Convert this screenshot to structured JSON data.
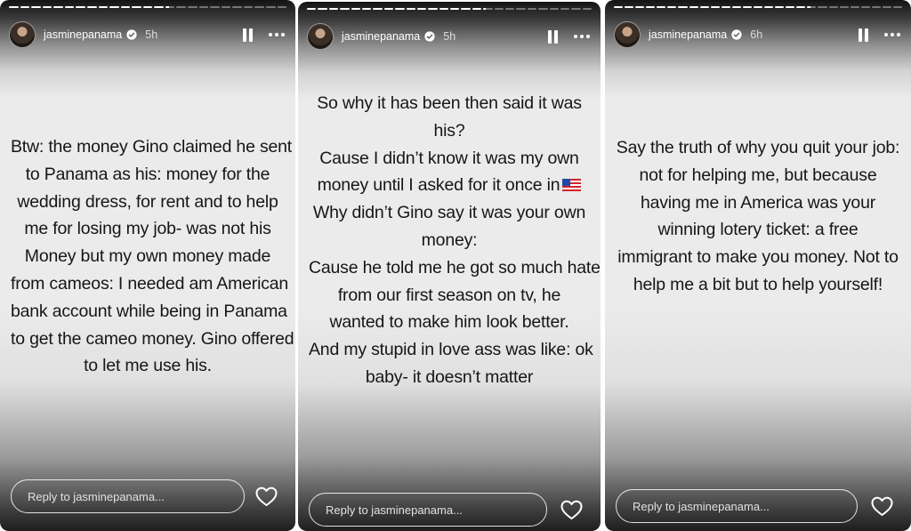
{
  "stories": [
    {
      "username": "jasminepanama",
      "time": "5h",
      "progress": [
        1,
        1,
        1,
        1,
        1,
        1,
        1,
        1,
        1,
        1,
        1,
        1,
        1,
        1,
        0.35,
        0,
        0,
        0,
        0,
        0,
        0,
        0,
        0,
        0,
        0
      ],
      "lines": [
        "Btw: the money Gino claimed he sent",
        "to Panama as his: money for the",
        "wedding dress, for rent and to help",
        "me for losing my job- was not his",
        "Money but my own money made",
        "from cameos: I needed am American",
        "bank account while being in Panama",
        "to get the cameo money. Gino offered",
        "to let me use his."
      ],
      "reply_placeholder": "Reply to jasminepanama..."
    },
    {
      "username": "jasminepanama",
      "time": "5h",
      "progress": [
        1,
        1,
        1,
        1,
        1,
        1,
        1,
        1,
        1,
        1,
        1,
        1,
        1,
        1,
        1,
        1,
        0.3,
        0,
        0,
        0,
        0,
        0,
        0,
        0,
        0,
        0
      ],
      "lines": [
        "So why it has been then said it was",
        "his?",
        "Cause I didn’t know it was my own",
        "money until I asked for it once in",
        "Why didn’t Gino say it was your own",
        "money:",
        "Cause he told me he got so much hate",
        "from our first season on tv, he",
        "wanted to make him look better.",
        "And my stupid in love ass was like: ok",
        "baby- it doesn’t matter"
      ],
      "reply_placeholder": "Reply to jasminepanama..."
    },
    {
      "username": "jasminepanama",
      "time": "6h",
      "progress": [
        1,
        1,
        1,
        1,
        1,
        1,
        1,
        1,
        1,
        1,
        1,
        1,
        1,
        1,
        1,
        1,
        1,
        1,
        0.4,
        0,
        0,
        0,
        0,
        0,
        0,
        0,
        0
      ],
      "lines": [
        "Say the truth of why you quit your job:",
        "not for helping me, but because",
        "having me in America was your",
        "winning lotery ticket: a free",
        "immigrant to make you money. Not to",
        "help me a bit but to help yourself!"
      ],
      "reply_placeholder": "Reply to jasminepanama..."
    }
  ],
  "icons": {
    "verified": "verified-badge-icon",
    "pause": "pause-icon",
    "more": "more-options-icon",
    "heart": "heart-icon",
    "flag": "us-flag-icon"
  },
  "colors": {
    "text": "#161616",
    "header_text": "#ffffff",
    "background_light": "#ebebeb",
    "background_dark": "#131313"
  }
}
